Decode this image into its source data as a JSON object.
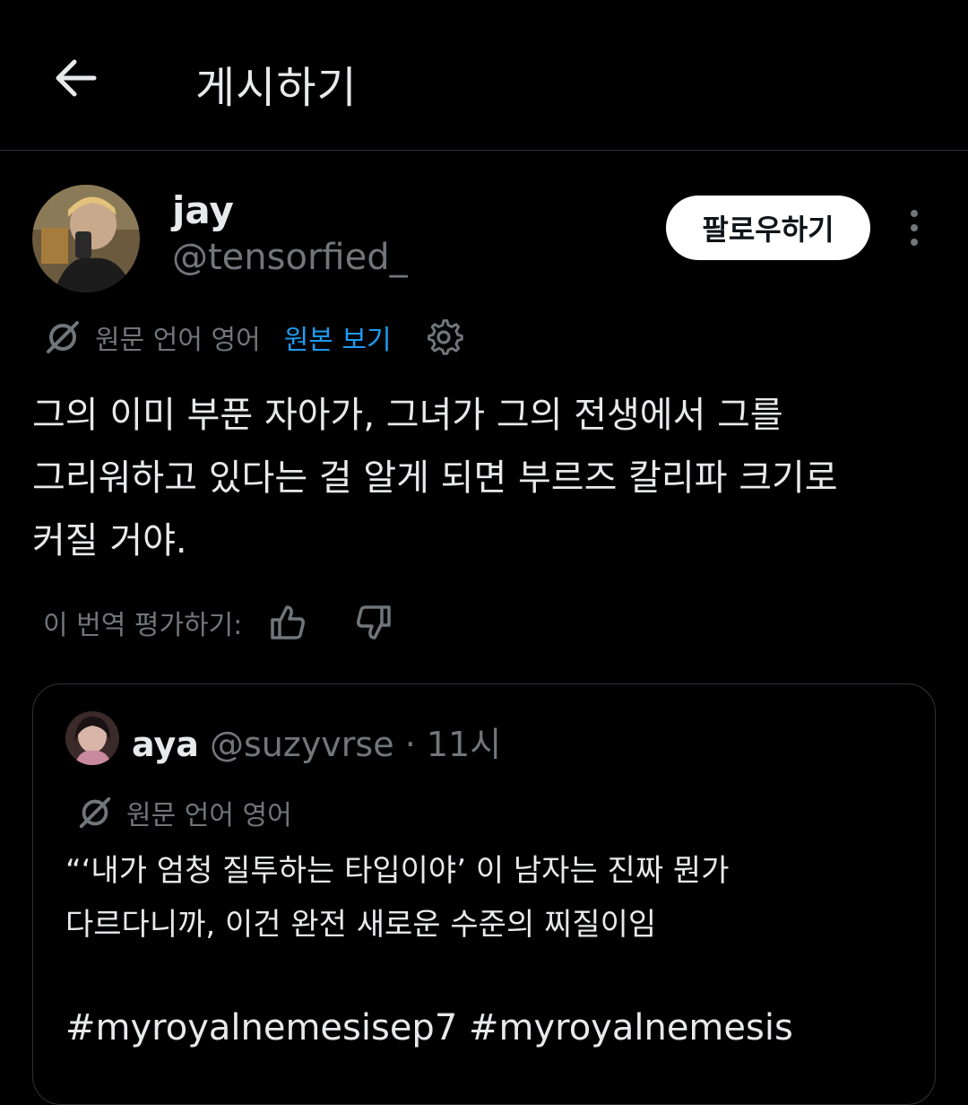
{
  "header": {
    "title": "게시하기"
  },
  "post": {
    "author": {
      "name": "jay",
      "handle": "@tensorfied_"
    },
    "follow_label": "팔로우하기",
    "translation": {
      "source_label": "원문 언어 영어",
      "show_original_label": "원본 보기"
    },
    "body": "그의 이미 부푼 자아가, 그녀가 그의 전생에서 그를\n그리워하고 있다는 걸 알게 되면 부르즈 칼리파 크기로\n커질 거야.",
    "rate_label": "이 번역 평가하기:"
  },
  "quote": {
    "author": {
      "name": "aya",
      "handle": "@suzyvrse",
      "separator": "·",
      "time": "11시"
    },
    "source_label": "원문 언어 영어",
    "body": "“‘내가 엄청 질투하는 타입이야’ 이 남자는 진짜 뭔가\n다르다니까, 이건 완전 새로운 수준의 찌질이임",
    "hashtags": "#myroyalnemesisep7 #myroyalnemesis"
  },
  "icons": {
    "back": "back-arrow-icon",
    "more": "more-vertical-icon",
    "translate": "translate-icon",
    "settings": "gear-icon",
    "thumbs_up": "thumbs-up-icon",
    "thumbs_down": "thumbs-down-icon"
  },
  "colors": {
    "background": "#000000",
    "text": "#e7e9ea",
    "muted": "#71767b",
    "link": "#1d9bf0",
    "divider": "#2f3336"
  }
}
